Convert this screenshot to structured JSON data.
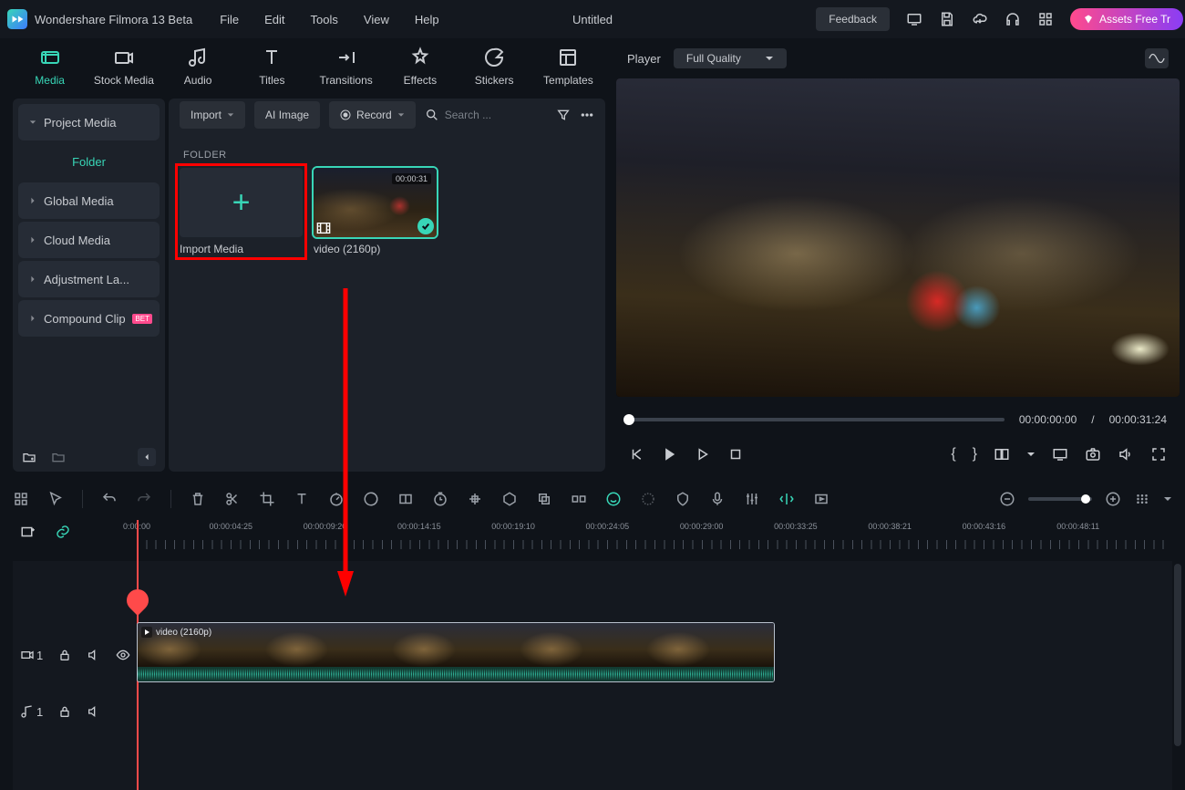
{
  "app": {
    "name": "Wondershare Filmora 13 Beta",
    "doc": "Untitled"
  },
  "menu": [
    "File",
    "Edit",
    "Tools",
    "View",
    "Help"
  ],
  "title_right": {
    "feedback": "Feedback",
    "assets": "Assets Free Tr"
  },
  "tabs": [
    {
      "label": "Media"
    },
    {
      "label": "Stock Media"
    },
    {
      "label": "Audio"
    },
    {
      "label": "Titles"
    },
    {
      "label": "Transitions"
    },
    {
      "label": "Effects"
    },
    {
      "label": "Stickers"
    },
    {
      "label": "Templates"
    }
  ],
  "sidebar": {
    "project_media": "Project Media",
    "folder": "Folder",
    "items": [
      "Global Media",
      "Cloud Media",
      "Adjustment La...",
      "Compound Clip"
    ],
    "badge": "BET"
  },
  "mp": {
    "import": "Import",
    "ai": "AI Image",
    "record": "Record",
    "search": "Search ...",
    "folder_label": "FOLDER",
    "import_media": "Import Media",
    "video_name": "video (2160p)",
    "video_dur": "00:00:31"
  },
  "player": {
    "label": "Player",
    "quality": "Full Quality",
    "t_cur": "00:00:00:00",
    "t_sep": "/",
    "t_tot": "00:00:31:24"
  },
  "ruler": [
    "0:00:00",
    "00:00:04:25",
    "00:00:09:20",
    "00:00:14:15",
    "00:00:19:10",
    "00:00:24:05",
    "00:00:29:00",
    "00:00:33:25",
    "00:00:38:21",
    "00:00:43:16",
    "00:00:48:11"
  ],
  "clip": {
    "name": "video (2160p)"
  },
  "tracks": {
    "v": "1",
    "a": "1"
  }
}
